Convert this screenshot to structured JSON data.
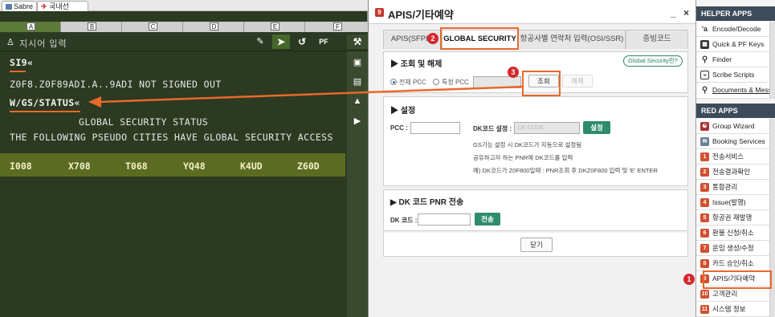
{
  "terminal": {
    "tabs": [
      {
        "label": "Sabre"
      },
      {
        "label": "국내선"
      }
    ],
    "sessions": [
      "A",
      "B",
      "C",
      "D",
      "E",
      "F"
    ],
    "command_placeholder": "지시어 입력",
    "toolbar": {
      "edit_icon": "edit-icon",
      "send_icon": "send-icon",
      "history_icon": "history-icon",
      "pf_label": "PF"
    },
    "lines": [
      "SI9«",
      "Z0F8.Z0F89ADI.A..9ADI NOT SIGNED OUT",
      "W/GS/STATUS«",
      "GLOBAL SECURITY STATUS",
      "THE FOLLOWING PSEUDO CITIES HAVE GLOBAL SECURITY ACCESS"
    ],
    "pccs": [
      "I008",
      "X708",
      "T068",
      "YQ48",
      "K4UD",
      "Z60D"
    ]
  },
  "dialog": {
    "title": "APIS/기타예약",
    "window_controls": "_ ×",
    "tabs": [
      "APIS(SFPD)",
      "GLOBAL SECURITY",
      "항공사별 연락처 입력(OSI/SSR)",
      "증빙코드"
    ],
    "active_tab": "GLOBAL SECURITY",
    "section1": {
      "title": "▶ 조회 및 해제",
      "link": "Global Security란?",
      "radio_all": "전체 PCC",
      "radio_specific": "특정 PCC",
      "query_button": "조회",
      "release_button": "해제"
    },
    "section2": {
      "title": "▶ 설정",
      "pcc_label": "PCC :",
      "dk_label": "DK코드 설정 :",
      "dk_placeholder": "DK CODE",
      "set_button": "설정",
      "notes": [
        "GS기능 설정 시 DK코드가 자동으로 설정됨",
        "공유하고자 하는 PNR에 DK코드를 입력",
        "예) DK코드가 Z0F800일때 : PNR조회 후 DKZ0F800 입력 및 'E' ENTER"
      ]
    },
    "section3": {
      "title": "▶ DK 코드 PNR 전송",
      "dk_label": "DK 코드 :",
      "send_button": "전송"
    },
    "close_button": "닫기"
  },
  "sidebar": {
    "helper_header": "HELPER APPS",
    "helper_items": [
      {
        "label": "Encode/Decode",
        "icon": "translate-icon"
      },
      {
        "label": "Quick & PF Keys",
        "icon": "keyboard-icon"
      },
      {
        "label": "Finder",
        "icon": "magnifier-icon"
      },
      {
        "label": "Scribe Scripts",
        "icon": "script-icon"
      },
      {
        "label": "Documents & Messaging",
        "icon": "pin-icon"
      }
    ],
    "red_header": "RED APPS",
    "red_items": [
      {
        "label": "Group Wizard",
        "icon": "group-icon"
      },
      {
        "label": "Booking Services",
        "icon": "booking-icon"
      },
      {
        "num": "1",
        "label": "전송서비스"
      },
      {
        "num": "2",
        "label": "전송결과확인"
      },
      {
        "num": "3",
        "label": "통합관리"
      },
      {
        "num": "4",
        "label": "Issue(발행)"
      },
      {
        "num": "5",
        "label": "항공권 재발행"
      },
      {
        "num": "6",
        "label": "환불 신청/취소"
      },
      {
        "num": "7",
        "label": "운임 생성/수정"
      },
      {
        "num": "8",
        "label": "카드 승인/취소"
      },
      {
        "num": "9",
        "label": "APIS/기타예약"
      },
      {
        "num": "10",
        "label": "고객관리"
      },
      {
        "num": "11",
        "label": "시스템 정보"
      }
    ]
  },
  "annotations": {
    "m1": "1",
    "m2": "2",
    "m3": "3"
  },
  "colors": {
    "terminal_bg": "#2c3a21",
    "highlight": "#e8692b",
    "marker": "#d6262e",
    "button_green": "#2e8b6e"
  }
}
